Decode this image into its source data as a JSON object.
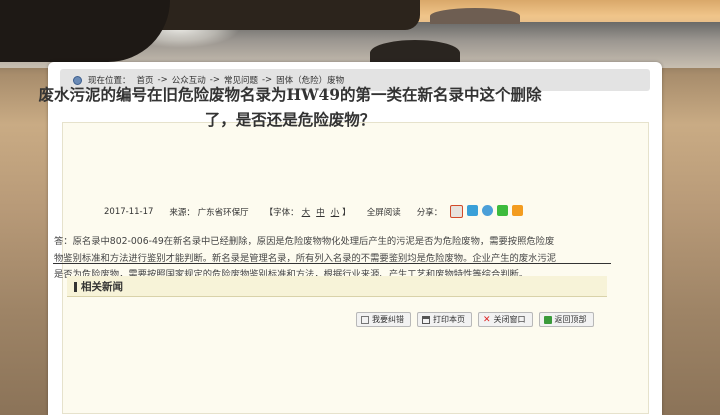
{
  "breadcrumb": {
    "label": "现在位置：",
    "items": [
      "首页",
      "公众互动",
      "常见问题",
      "固体（危险）废物"
    ],
    "separator": "->"
  },
  "article": {
    "title": "废水污泥的编号在旧危险废物名录为HW49的第一类在新名录中这个删除了，是否还是危险废物？",
    "date": "2017-11-17",
    "source": "来源：  广东省环保厅",
    "font_size_label": "【字体：",
    "font_sizes": [
      "大",
      "中",
      "小"
    ],
    "font_size_end": "】",
    "fullscreen": "全屏阅读",
    "share_label": "分享：",
    "share_icons": [
      "sina-weibo-icon",
      "qzone-icon",
      "qq-weibo-icon",
      "wechat-icon",
      "more-share-icon"
    ],
    "body": "答：原名录中802-006-49在新名录中已经删除，原因是危险废物物化处理后产生的污泥是否为危险废物，需要按照危险废物鉴别标准和方法进行鉴别才能判断。新名录是管理名录，所有列入名录的不需要鉴别均是危险废物。企业产生的废水污泥是否为危险废物，需要按照国家规定的危险废物鉴别标准和方法，根据行业来源、产生工艺和废物特性等综合判断。"
  },
  "related": {
    "title": "相关新闻"
  },
  "actions": {
    "correct": "我要纠错",
    "print": "打印本页",
    "close": "关闭窗口",
    "top": "返回顶部"
  },
  "colors": {
    "panel": "#ffffff",
    "article_bg": "#fdfbef",
    "related_bg": "#f7f3d8"
  }
}
